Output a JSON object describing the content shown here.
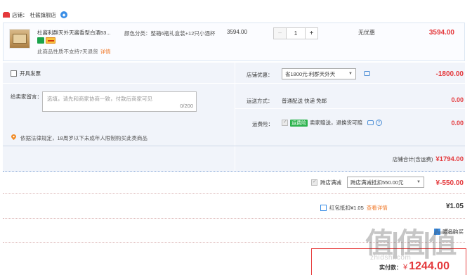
{
  "shop": {
    "label": "店铺：",
    "name": "杜酱旗舰店"
  },
  "item": {
    "title": "杜酱利群天外天酱香型白酒53...",
    "no_return": "此商品性质不支持7天退货",
    "detail_link": "详情",
    "sku_label": "颜色分类：",
    "sku_value": "整箱6瓶礼盒装+12只小酒杯",
    "unit_price": "3594.00",
    "quantity": "1",
    "qty_minus": "−",
    "qty_plus": "+",
    "discount": "无优惠",
    "line_total": "3594.00"
  },
  "invoice": {
    "label": "开具发票"
  },
  "message": {
    "label": "给卖家留言：",
    "placeholder": "选填，请先和商家协商一致，付款后商家可见",
    "count": "0/200"
  },
  "law_notice": "依据法律规定，18周岁以下未成年人限制购买此类商品",
  "shop_discount": {
    "label": "店铺优惠：",
    "value": "省1800元:利群天外天",
    "amount": "-1800.00"
  },
  "shipping": {
    "label": "运送方式：",
    "value": "普通配送 快递 免邮",
    "amount": "0.00"
  },
  "insurance": {
    "label": "运费险：",
    "tag": "运费险",
    "value": "卖家赠送，退换货可赔",
    "amount": "0.00"
  },
  "shop_total": {
    "label": "店铺合计(含运费)",
    "amount": "¥1794.00"
  },
  "cross_shop": {
    "label": "跨店满减",
    "value": "跨店满减抵扣550.00元",
    "amount": "¥-550.00"
  },
  "red_packet": {
    "label": "红包抵扣¥1.05",
    "link": "查看详情",
    "amount": "¥1.05"
  },
  "anonymous": {
    "label": "匿名购买"
  },
  "final": {
    "label": "实付款：",
    "currency": "¥",
    "amount": "1244.00"
  },
  "watermark": {
    "text": "值|值|值",
    "sub": "zhidshi.com"
  },
  "colors": {
    "accent_red": "#e4393c",
    "panel_bg": "#f1f4fa",
    "link_orange": "#f07a2b",
    "blue": "#3a8ee6"
  }
}
